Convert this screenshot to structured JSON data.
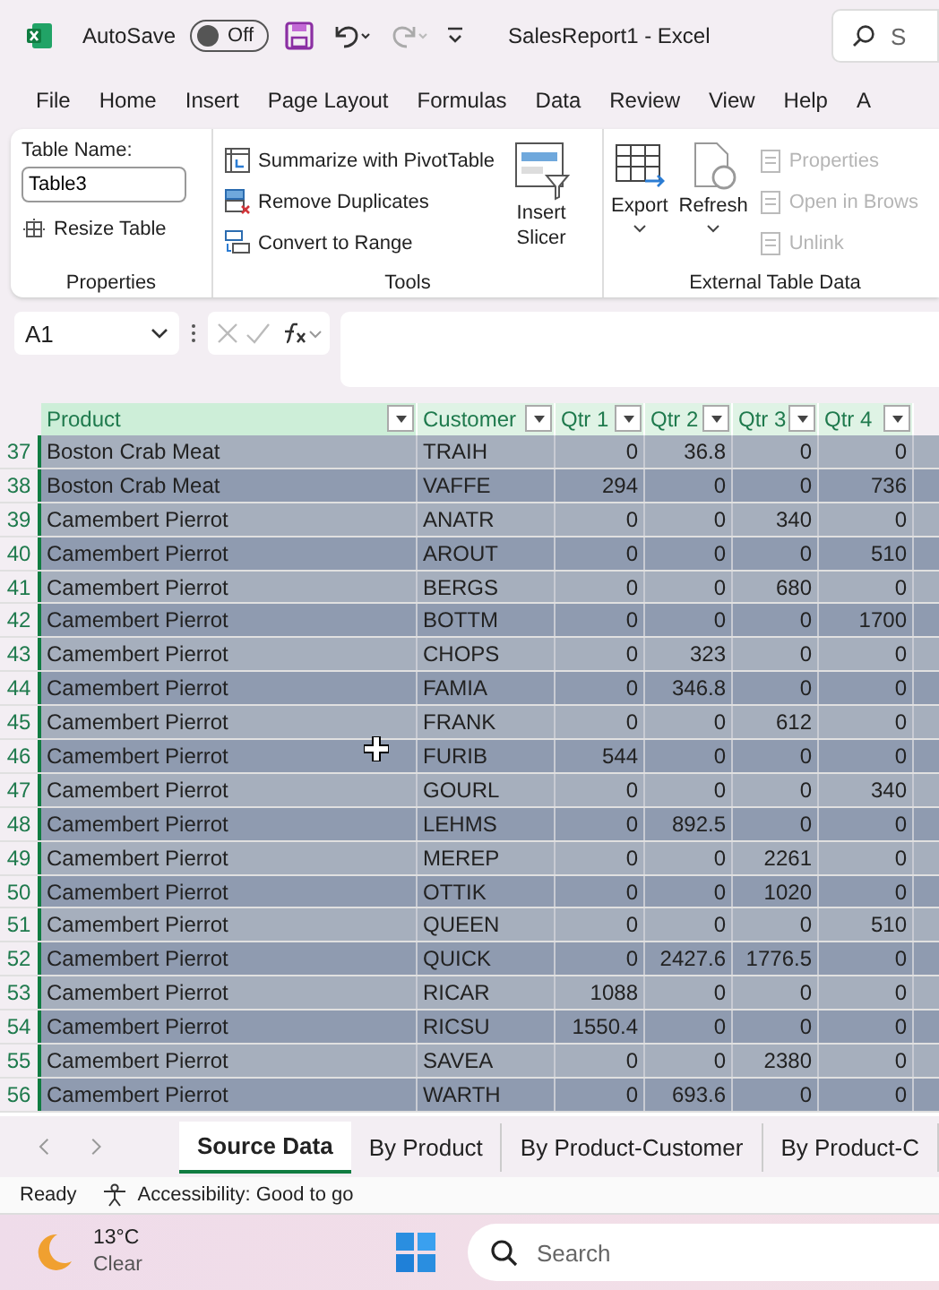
{
  "title_bar": {
    "autosave_label": "AutoSave",
    "autosave_state": "Off",
    "autosave_on": false,
    "title": "SalesReport1  -  Excel",
    "search_placeholder": "S"
  },
  "menu": [
    "File",
    "Home",
    "Insert",
    "Page Layout",
    "Formulas",
    "Data",
    "Review",
    "View",
    "Help",
    "A"
  ],
  "ribbon": {
    "properties": {
      "table_name_label": "Table Name:",
      "table_name": "Table3",
      "resize": "Resize Table",
      "group": "Properties"
    },
    "tools": {
      "items": [
        "Summarize with PivotTable",
        "Remove Duplicates",
        "Convert to Range"
      ],
      "slicer": [
        "Insert",
        "Slicer"
      ],
      "group": "Tools"
    },
    "external": {
      "export": "Export",
      "refresh": "Refresh",
      "items": [
        {
          "label": "Properties",
          "disabled": true
        },
        {
          "label": "Open in Brows",
          "disabled": true
        },
        {
          "label": "Unlink",
          "disabled": true
        }
      ],
      "group": "External Table Data"
    }
  },
  "formula_bar": {
    "name_box": "A1"
  },
  "table": {
    "columns": [
      "Product",
      "Customer",
      "Qtr 1",
      "Qtr 2",
      "Qtr 3",
      "Qtr 4"
    ],
    "rows": [
      {
        "num": "37",
        "cells": [
          "Boston Crab Meat",
          "TRAIH",
          "0",
          "36.8",
          "0",
          "0"
        ],
        "selected": true
      },
      {
        "num": "38",
        "cells": [
          "Boston Crab Meat",
          "VAFFE",
          "294",
          "0",
          "0",
          "736"
        ],
        "selected": true
      },
      {
        "num": "39",
        "cells": [
          "Camembert Pierrot",
          "ANATR",
          "0",
          "0",
          "340",
          "0"
        ],
        "selected": true
      },
      {
        "num": "40",
        "cells": [
          "Camembert Pierrot",
          "AROUT",
          "0",
          "0",
          "0",
          "510"
        ],
        "selected": true
      },
      {
        "num": "41",
        "cells": [
          "Camembert Pierrot",
          "BERGS",
          "0",
          "0",
          "680",
          "0"
        ],
        "selected": true
      },
      {
        "num": "42",
        "cells": [
          "Camembert Pierrot",
          "BOTTM",
          "0",
          "0",
          "0",
          "1700"
        ],
        "selected": true
      },
      {
        "num": "43",
        "cells": [
          "Camembert Pierrot",
          "CHOPS",
          "0",
          "323",
          "0",
          "0"
        ],
        "selected": true
      },
      {
        "num": "44",
        "cells": [
          "Camembert Pierrot",
          "FAMIA",
          "0",
          "346.8",
          "0",
          "0"
        ],
        "selected": true
      },
      {
        "num": "45",
        "cells": [
          "Camembert Pierrot",
          "FRANK",
          "0",
          "0",
          "612",
          "0"
        ],
        "selected": true
      },
      {
        "num": "46",
        "cells": [
          "Camembert Pierrot",
          "FURIB",
          "544",
          "0",
          "0",
          "0"
        ],
        "selected": true
      },
      {
        "num": "47",
        "cells": [
          "Camembert Pierrot",
          "GOURL",
          "0",
          "0",
          "0",
          "340"
        ],
        "selected": true
      },
      {
        "num": "48",
        "cells": [
          "Camembert Pierrot",
          "LEHMS",
          "0",
          "892.5",
          "0",
          "0"
        ],
        "selected": true
      },
      {
        "num": "49",
        "cells": [
          "Camembert Pierrot",
          "MEREP",
          "0",
          "0",
          "2261",
          "0"
        ],
        "selected": true
      },
      {
        "num": "50",
        "cells": [
          "Camembert Pierrot",
          "OTTIK",
          "0",
          "0",
          "1020",
          "0"
        ],
        "selected": true
      },
      {
        "num": "51",
        "cells": [
          "Camembert Pierrot",
          "QUEEN",
          "0",
          "0",
          "0",
          "510"
        ],
        "selected": true
      },
      {
        "num": "52",
        "cells": [
          "Camembert Pierrot",
          "QUICK",
          "0",
          "2427.6",
          "1776.5",
          "0"
        ],
        "selected": true
      },
      {
        "num": "53",
        "cells": [
          "Camembert Pierrot",
          "RICAR",
          "1088",
          "0",
          "0",
          "0"
        ],
        "selected": true
      },
      {
        "num": "54",
        "cells": [
          "Camembert Pierrot",
          "RICSU",
          "1550.4",
          "0",
          "0",
          "0"
        ],
        "selected": true
      },
      {
        "num": "55",
        "cells": [
          "Camembert Pierrot",
          "SAVEA",
          "0",
          "0",
          "2380",
          "0"
        ],
        "selected": true
      },
      {
        "num": "56",
        "cells": [
          "Camembert Pierrot",
          "WARTH",
          "0",
          "693.6",
          "0",
          "0"
        ],
        "selected": true
      }
    ]
  },
  "sheet_tabs": [
    {
      "label": "Source Data",
      "selected": true
    },
    {
      "label": "By Product",
      "selected": false
    },
    {
      "label": "By Product-Customer",
      "selected": false
    },
    {
      "label": "By Product-C",
      "selected": false
    }
  ],
  "status_bar": {
    "mode": "Ready",
    "accessibility": "Accessibility: Good to go"
  },
  "taskbar": {
    "temperature": "13°C",
    "weather": "Clear",
    "search_placeholder": "Search"
  }
}
